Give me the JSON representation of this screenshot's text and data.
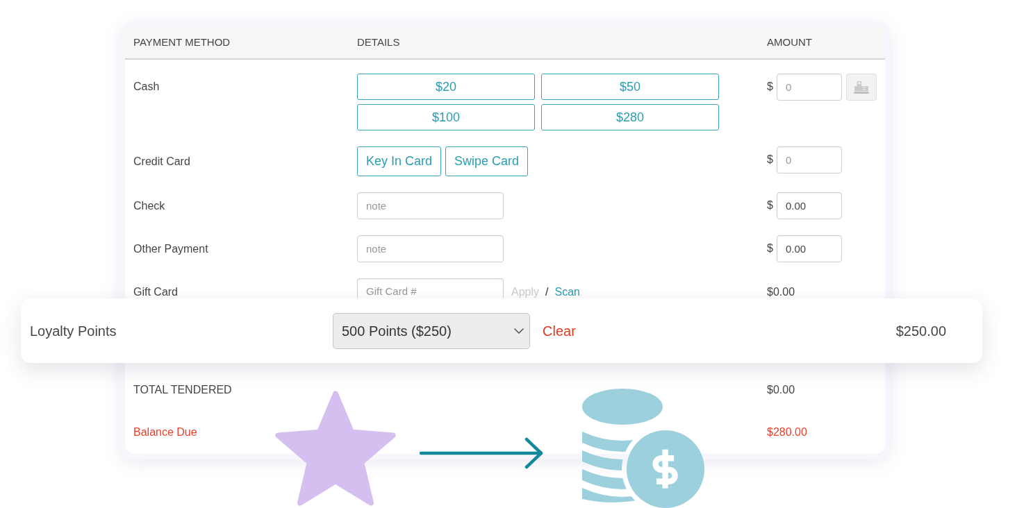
{
  "columns": [
    "PAYMENT METHOD",
    "DETAILS",
    "AMOUNT"
  ],
  "rows": [
    {
      "kind": "cash",
      "label": "Cash",
      "quick_amounts": [
        "$20",
        "$50",
        "$100",
        "$280"
      ],
      "currency": "$",
      "amount": {
        "placeholder": "0"
      }
    },
    {
      "kind": "card",
      "label": "Credit Card",
      "buttons": [
        "Key In Card",
        "Swipe Card"
      ],
      "currency": "$",
      "amount": {
        "placeholder": "0"
      }
    },
    {
      "kind": "note",
      "label": "Check",
      "note": {
        "placeholder": "note"
      },
      "currency": "$",
      "amount": {
        "value": "0.00"
      }
    },
    {
      "kind": "note",
      "label": "Other Payment",
      "note": {
        "placeholder": "note"
      },
      "currency": "$",
      "amount": {
        "value": "0.00"
      }
    },
    {
      "kind": "gift",
      "label": "Gift Card",
      "card_number": {
        "placeholder": "Gift Card #"
      },
      "apply": {
        "label": "Apply",
        "disabled": true
      },
      "separator": "/",
      "scan": "Scan",
      "amount_text": "$0.00"
    }
  ],
  "totals": [
    {
      "kind": "total",
      "label": "TOTAL TENDERED",
      "amount": "$0.00"
    },
    {
      "kind": "due",
      "label": "Balance Due",
      "amount": "$280.00"
    }
  ],
  "loyalty": {
    "label": "Loyalty Points",
    "selection": "500 Points ($250)",
    "clear": "Clear",
    "amount": "$250.00"
  }
}
